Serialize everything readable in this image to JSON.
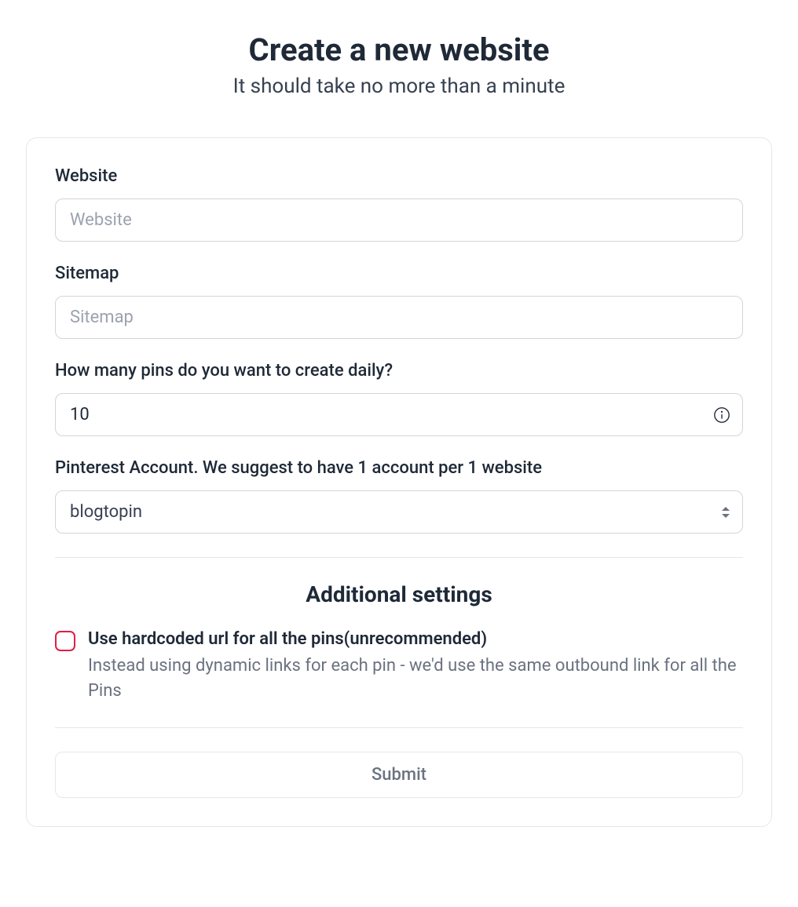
{
  "header": {
    "title": "Create a new website",
    "subtitle": "It should take no more than a minute"
  },
  "form": {
    "website": {
      "label": "Website",
      "placeholder": "Website",
      "value": ""
    },
    "sitemap": {
      "label": "Sitemap",
      "placeholder": "Sitemap",
      "value": ""
    },
    "pins": {
      "label": "How many pins do you want to create daily?",
      "value": "10"
    },
    "account": {
      "label": "Pinterest Account. We suggest to have 1 account per 1 website",
      "selected": "blogtopin"
    }
  },
  "additional": {
    "heading": "Additional settings",
    "hardcoded": {
      "label": "Use hardcoded url for all the pins(unrecommended)",
      "description": "Instead using dynamic links for each pin - we'd use the same outbound link for all the Pins",
      "checked": false
    }
  },
  "submit": {
    "label": "Submit"
  }
}
